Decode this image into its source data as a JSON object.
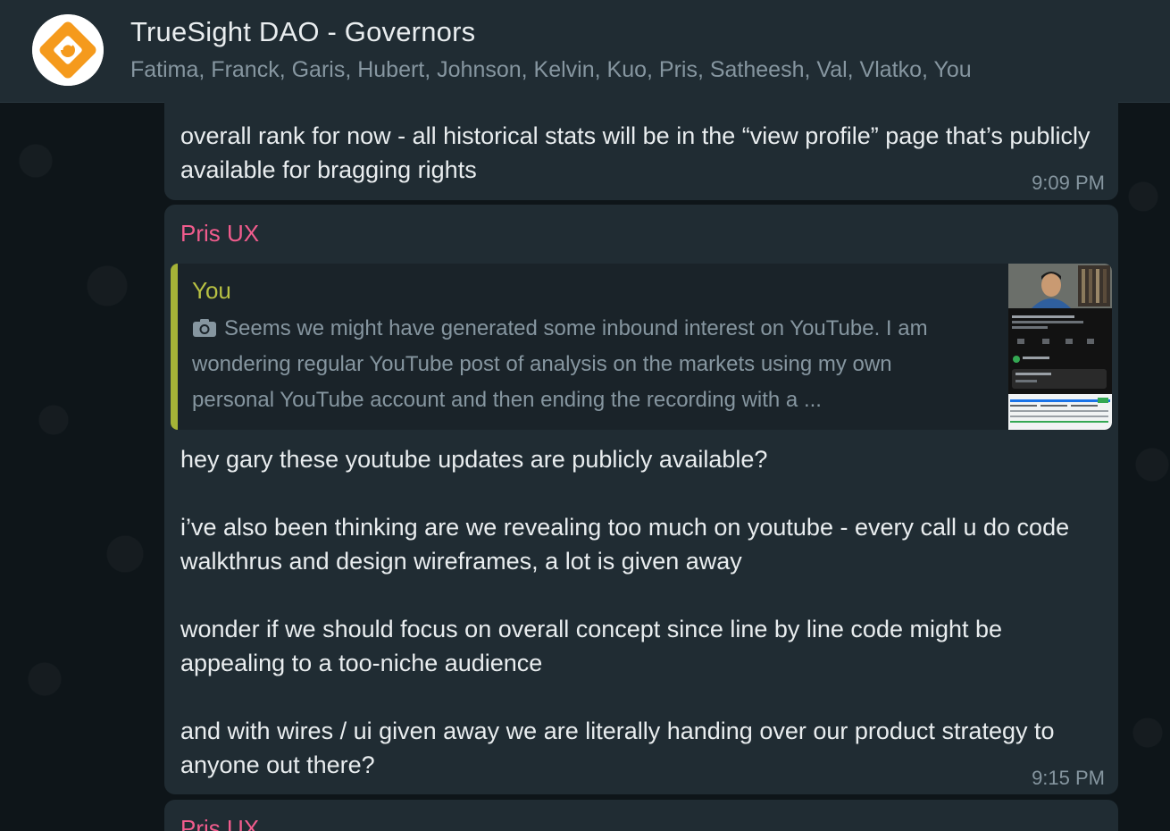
{
  "header": {
    "title": "TrueSight DAO - Governors",
    "members": "Fatima, Franck, Garis, Hubert, Johnson, Kelvin, Kuo, Pris, Satheesh, Val, Vlatko, You"
  },
  "messages": [
    {
      "text": "overall rank for now - all historical stats will be in the “view profile” page that’s publicly available for bragging rights",
      "time": "9:09 PM"
    },
    {
      "sender": "Pris UX",
      "quote": {
        "author": "You",
        "text": "Seems we might have generated some inbound interest on YouTube. I am wondering regular YouTube post of analysis on the markets using my own personal YouTube account and then ending the recording with a ..."
      },
      "text": "hey gary these youtube updates are publicly available?\n\ni’ve also been thinking are we revealing too much on youtube - every call u do code walkthrus and design wireframes, a lot is given away\n\nwonder if we should focus on overall concept since line by line code might be appealing to a too-niche audience\n\nand with wires / ui given away we are literally handing over our product strategy to anyone out there?",
      "time": "9:15 PM"
    },
    {
      "sender": "Pris UX"
    }
  ],
  "colors": {
    "header_bg": "#202c33",
    "bubble_bg": "#202c33",
    "sender_color": "#f15c8d",
    "quote_bar": "#a5b337",
    "quote_author": "#b8c143",
    "avatar_orange": "#f59a1c"
  },
  "icons": {
    "avatar": "truesight-logo-icon",
    "quote_media": "camera-icon"
  }
}
